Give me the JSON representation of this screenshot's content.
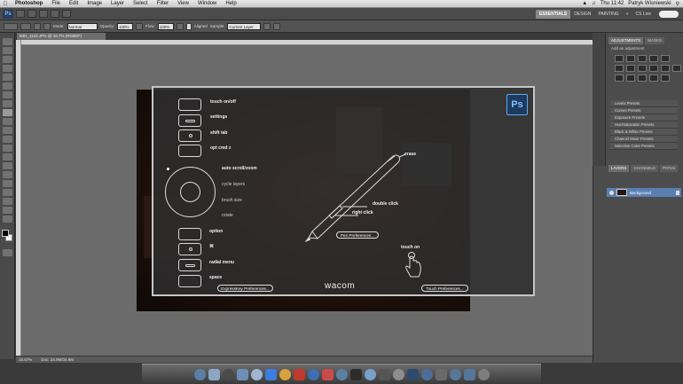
{
  "menubar": {
    "app_name": "Photoshop",
    "items": [
      "File",
      "Edit",
      "Image",
      "Layer",
      "Select",
      "Filter",
      "View",
      "Window",
      "Help"
    ],
    "clock": "Thu 11:42",
    "user": "Patryk Wisniewski"
  },
  "appbar": {
    "workspaces": [
      "ESSENTIALS",
      "DESIGN",
      "PAINTING"
    ],
    "active_workspace": "ESSENTIALS",
    "cs_live": "CS Live"
  },
  "options": {
    "mode_label": "Mode:",
    "mode_value": "Normal",
    "opacity_label": "Opacity:",
    "opacity_value": "100%",
    "flow_label": "Flow:",
    "flow_value": "100%",
    "aligned_label": "Aligned",
    "sample_label": "Sample:",
    "sample_value": "Current Layer"
  },
  "document": {
    "tab_title": "IMG_1142.JPG @ 16.7% (RGB/8*)",
    "zoom": "16.67%",
    "doc_info": "Doc: 34.9M/34.9M"
  },
  "panels": {
    "top_tabs": [
      "ADJUSTMENTS",
      "MASKS"
    ],
    "add_adjustment": "Add an adjustment",
    "presets": [
      "Levels Presets",
      "Curves Presets",
      "Exposure Presets",
      "Hue/Saturation Presets",
      "Black & White Presets",
      "Channel Mixer Presets",
      "Selective Color Presets"
    ],
    "layer_tabs": [
      "LAYERS",
      "CHANNELS",
      "PATHS"
    ],
    "layer_name": "Background"
  },
  "wacom": {
    "expresskeys_top": [
      "touch on/off",
      "settings",
      "shift tab",
      "opt cmd z"
    ],
    "touch_ring": [
      "auto scroll/zoom",
      "cycle layers",
      "brush size",
      "rotate"
    ],
    "expresskeys_bottom": [
      "option",
      "⌘",
      "radial menu",
      "space"
    ],
    "pen": {
      "eraser": "erase",
      "upper_button": "double click",
      "lower_button": "right click"
    },
    "touch_label": "touch on",
    "buttons": {
      "expresskey_prefs": "ExpressKey Preferences...",
      "pen_prefs": "Pen Preferences...",
      "touch_prefs": "Touch Preferences..."
    },
    "brand": "wacom",
    "ps_badge": "Ps"
  },
  "colors": {
    "overlay_bg": "#2e2e2e",
    "overlay_border": "#c6c6c6",
    "ps_blue": "#5ea9f3"
  }
}
